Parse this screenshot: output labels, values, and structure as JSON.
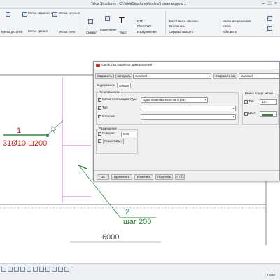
{
  "window": {
    "title": "Tekla Structures - C:\\TeklaStructuresModels\\Новая модель 1"
  },
  "ribbon": {
    "items": [
      {
        "label": "Метка деталей"
      },
      {
        "label": "Метка сварного шва"
      },
      {
        "label": "Метка уровня"
      },
      {
        "label": "Метка сечения"
      },
      {
        "label": "Метка узла"
      },
      {
        "label": "Символ"
      },
      {
        "label": "Примечание"
      },
      {
        "label": "Текст"
      },
      {
        "label": "RTF"
      },
      {
        "label": "DWG/DXF"
      },
      {
        "label": "Изображение"
      },
      {
        "label": "Расставить объекты"
      },
      {
        "label": "Выровнять"
      },
      {
        "label": "Скрыть/показать"
      },
      {
        "label": "Метка исправления"
      },
      {
        "label": "Связь"
      },
      {
        "label": "Обновить"
      }
    ]
  },
  "drawing": {
    "mark1_number": "1",
    "mark1_text": "31Ø10 ш200",
    "mark2_number": "2",
    "mark2_text": "шаг 200",
    "dimension": "6000"
  },
  "dialog": {
    "title": "Свойства маркера армирования",
    "save_button": "Сохранить",
    "load_button": "Загрузить",
    "load_value": "standard",
    "save_as_button": "Сохранить как",
    "save_as_value": "standard",
    "tabs": [
      "Содержимое",
      "Общие"
    ],
    "leader_group": "Линия выноски",
    "rebar_group_mark_label": "Метка группы арматуры:",
    "rebar_group_mark_value": "Одна линия выноски на строку",
    "type_label": "Тип:",
    "arrow_label": "Стрелка:",
    "frame_group": "Рамка вокруг метки",
    "frame_type_label": "Тип:",
    "frame_type_value": "12:1",
    "color_label": "Цвет:",
    "placement_group": "Размещение",
    "rotation_label": "Поворот:",
    "rotation_value": "0.00",
    "placing_button": "Поместить...",
    "ok_button": "OK",
    "apply_button": "Применить",
    "modify_button": "Изменить",
    "get_button": "Получить",
    "toggle_button": "✓ / ☐"
  },
  "status": {
    "left_text": "",
    "right_text": "Пано"
  },
  "colors": {
    "mark_red": "#d61f1f",
    "mark_green": "#2e8b3a",
    "gridline_magenta": "#c040c0",
    "dialog_bg": "#f0f0f0"
  }
}
